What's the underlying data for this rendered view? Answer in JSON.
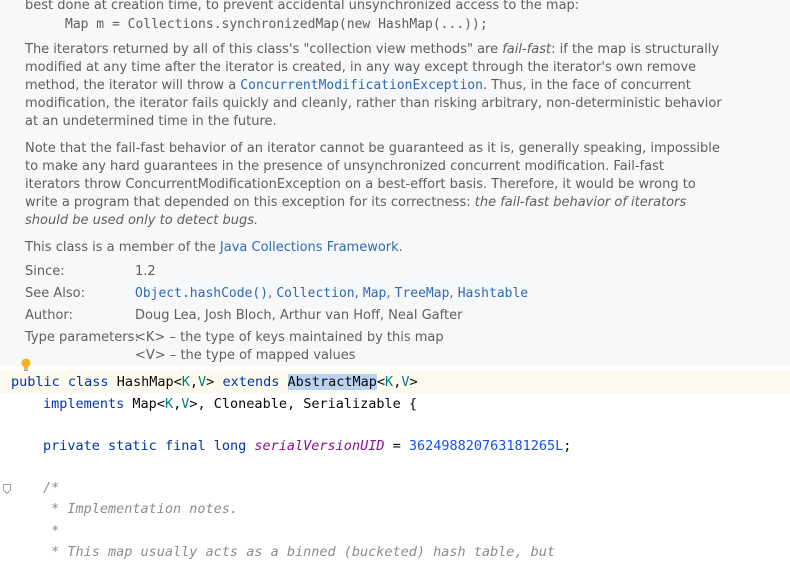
{
  "doc": {
    "p0_l1": "best done at creation time, to prevent accidental unsynchronized access to the map:",
    "p0_code": "Map m = Collections.synchronizedMap(new HashMap(...));",
    "p1_l1a": "The iterators returned by all of this class's \"collection view methods\" are ",
    "p1_l1b": "fail-fast",
    "p1_l1c": ": if the map is structurally",
    "p1_l2": "modified at any time after the iterator is created, in any way except through the iterator's own remove",
    "p1_l3a": "method, the iterator will throw a ",
    "p1_l3b": "ConcurrentModificationException",
    "p1_l3c": ". Thus, in the face of concurrent",
    "p1_l4": "modification, the iterator fails quickly and cleanly, rather than risking arbitrary, non-deterministic behavior",
    "p1_l5": "at an undetermined time in the future.",
    "p2_l1": "Note that the fail-fast behavior of an iterator cannot be guaranteed as it is, generally speaking, impossible",
    "p2_l2": "to make any hard guarantees in the presence of unsynchronized concurrent modification. Fail-fast",
    "p2_l3": "iterators throw ConcurrentModificationException on a best-effort basis. Therefore, it would be wrong to",
    "p2_l4a": "write a program that depended on this exception for its correctness: ",
    "p2_l4b": "the fail-fast behavior of iterators",
    "p2_l5": "should be used only to detect bugs.",
    "p3a": "This class is a member of the ",
    "p3b": "Java Collections Framework",
    "p3c": ".",
    "since_label": "Since:",
    "since_value": "1.2",
    "seealso_label": "See Also:",
    "seealso": [
      "Object.hashCode()",
      "Collection",
      "Map",
      "TreeMap",
      "Hashtable"
    ],
    "sep": ", ",
    "author_label": "Author:",
    "author_value": "Doug Lea, Josh Bloch, Arthur van Hoff, Neal Gafter",
    "typeparams_label": "Type parameters:",
    "tp1": "<K> – the type of keys maintained by this map",
    "tp2": "<V> – the type of mapped values"
  },
  "code": {
    "public": "public",
    "class": "class",
    "classname": "HashMap",
    "extends": "extends",
    "abstractmap": "AbstractMap",
    "K": "K",
    "V": "V",
    "lt": "<",
    "gt": ">",
    "comma": ",",
    "implements": "implements",
    "map": "Map",
    "cloneable": "Cloneable",
    "serializable": "Serializable",
    "brace": "{",
    "private": "private",
    "static": "static",
    "final": "final",
    "long": "long",
    "field": "serialVersionUID",
    "eq": " = ",
    "num": "362498820763181265L",
    "semi": ";",
    "c1": "/*",
    "c2": " * Implementation notes.",
    "c3": " *",
    "c4": " * This map usually acts as a binned (bucketed) hash table, but"
  }
}
